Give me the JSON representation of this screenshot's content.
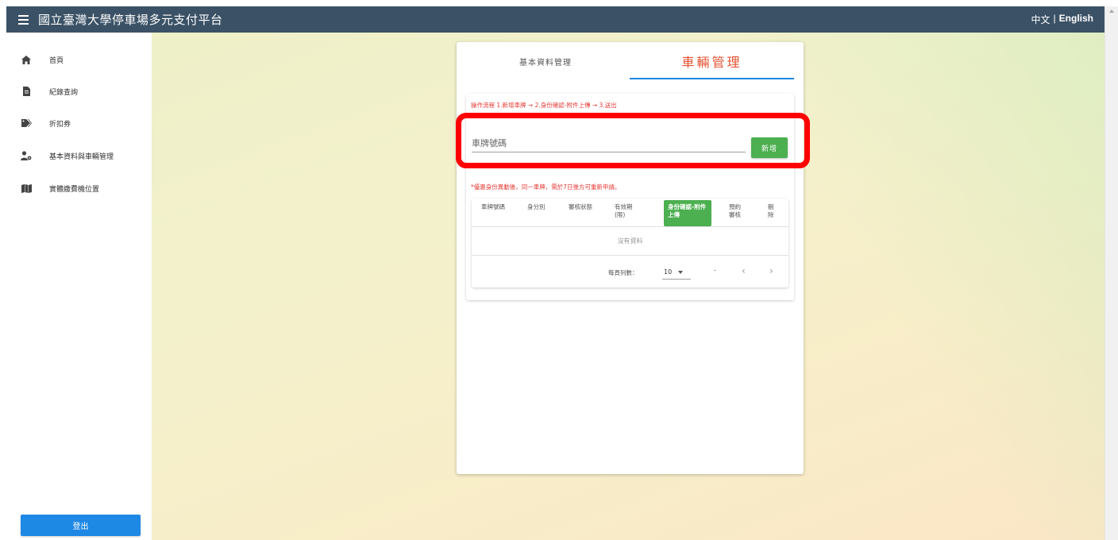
{
  "header": {
    "title": "國立臺灣大學停車場多元支付平台",
    "lang_zh": "中文",
    "lang_sep": "|",
    "lang_en": "English"
  },
  "sidebar": {
    "items": [
      {
        "label": "首頁",
        "icon": "home-icon"
      },
      {
        "label": "紀錄查詢",
        "icon": "receipt-icon"
      },
      {
        "label": "折扣券",
        "icon": "tags-icon"
      },
      {
        "label": "基本資料與車輛管理",
        "icon": "user-cog-icon"
      },
      {
        "label": "實體繳費機位置",
        "icon": "map-icon"
      }
    ],
    "logout_label": "登出"
  },
  "tabs": {
    "basic": "基本資料管理",
    "vehicle": "車輛管理"
  },
  "vehicle": {
    "flow_text": "操作流程 1.新增車牌 → 2.身份確認-附件上傳 → 3.送出",
    "plate_placeholder": "車牌號碼",
    "add_label": "新增",
    "note_text": "*優惠身份異動後，同一車牌，需於7日後方可重新申請。"
  },
  "table": {
    "headers": [
      "車牌號碼",
      "身分別",
      "審核狀態",
      "有效期(限)",
      "身份確認-附件上傳",
      "預約審核",
      "刪除"
    ],
    "empty_text": "沒有資料",
    "rows_per_page_label": "每頁列數：",
    "rows_per_page_value": "10",
    "range_text": "-"
  },
  "colors": {
    "topbar": "#3b5266",
    "accent_blue": "#1e88e5",
    "active_tab": "#e65132",
    "green": "#4caf50",
    "warning_red": "#e53935",
    "highlight": "#ff0000"
  }
}
